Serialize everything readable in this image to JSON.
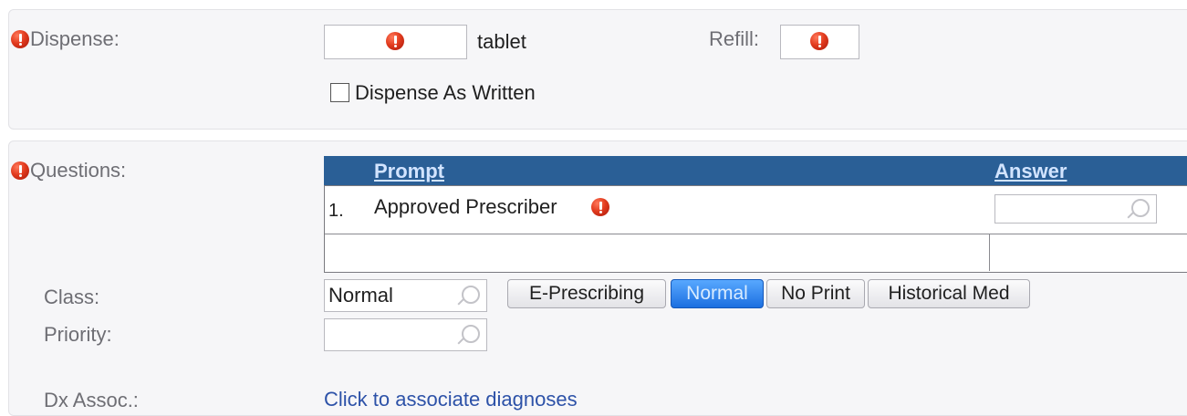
{
  "dispense": {
    "label": "Dispense:",
    "unit": "tablet",
    "refill_label": "Refill:",
    "daw_label": "Dispense As Written"
  },
  "questions": {
    "label": "Questions:",
    "columns": {
      "prompt": "Prompt",
      "answer": "Answer"
    },
    "rows": [
      {
        "number": "1.",
        "prompt": "Approved Prescriber",
        "answer": ""
      }
    ]
  },
  "class": {
    "label": "Class:",
    "value": "Normal",
    "buttons": [
      "E-Prescribing",
      "Normal",
      "No Print",
      "Historical Med"
    ],
    "active": "Normal"
  },
  "priority": {
    "label": "Priority:",
    "value": ""
  },
  "dx_assoc": {
    "label": "Dx Assoc.:",
    "link": "Click to associate diagnoses"
  },
  "colors": {
    "required": "#e23b1e",
    "header": "#2a5f96",
    "active_button": "#1c6fe0"
  }
}
